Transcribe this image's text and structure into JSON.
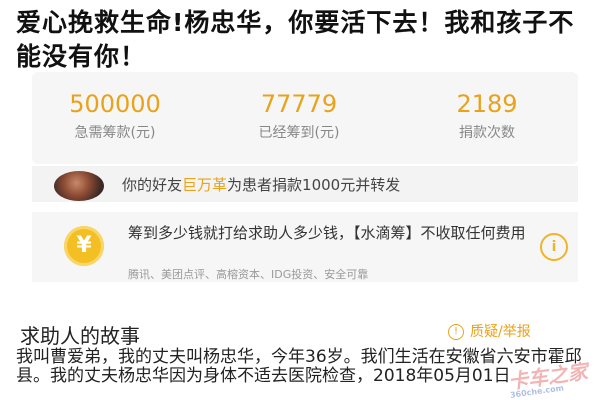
{
  "title": "爱心挽救生命!杨忠华，你要活下去！我和孩子不能没有你！",
  "stats": [
    {
      "value": "500000",
      "label": "急需筹款(元)"
    },
    {
      "value": "77779",
      "label": "已经筹到(元)"
    },
    {
      "value": "2189",
      "label": "捐款次数"
    }
  ],
  "friend": {
    "prefix": "你的好友",
    "name": "巨万革",
    "suffix": "为患者捐款1000元并转发"
  },
  "notice": {
    "main": "筹到多少钱就打给求助人多少钱，【水滴筹】不收取任何费用",
    "partners": "腾讯、美团点评、高榕资本、IDG投资、安全可靠",
    "icon": "yen-icon"
  },
  "story": {
    "title": "求助人的故事",
    "report_label": "质疑/举报",
    "body": "我叫曹爱弟，我的丈夫叫杨忠华，今年36岁。我们生活在安徽省六安市霍邱县。我的丈夫杨忠华因为身体不适去医院检查，2018年05月01日"
  },
  "watermark": {
    "text": "卡车之家",
    "sub": "360che.com"
  },
  "colors": {
    "accent": "#e9a21a",
    "yen": "#f3bf23"
  }
}
